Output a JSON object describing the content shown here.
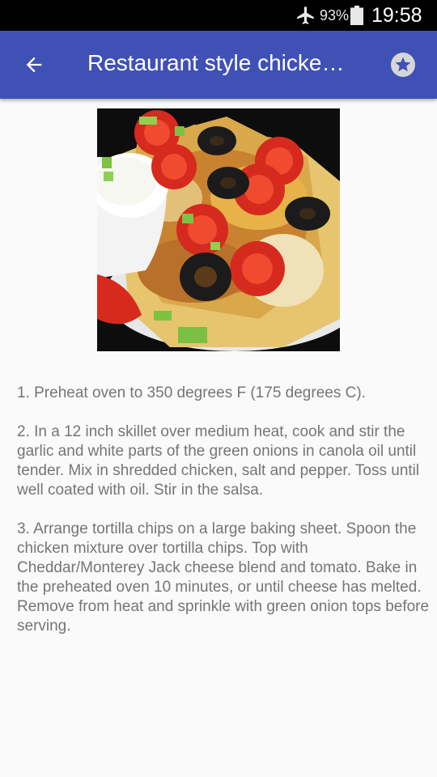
{
  "status_bar": {
    "battery": "93%",
    "time": "19:58",
    "icons": [
      "airplane-mode-icon",
      "battery-icon"
    ]
  },
  "app_bar": {
    "title": "Restaurant style chicke…",
    "back_icon": "arrow-left-icon",
    "favorite_icon": "star-icon",
    "color": "#3f51b5"
  },
  "recipe": {
    "image_subject": "nachos with chicken, cheese, tomatoes, black olives, green onions and sour cream",
    "steps": [
      "1. Preheat oven to 350 degrees F (175 degrees C).",
      "2. In a 12 inch skillet over medium heat, cook and stir the garlic and white parts of the green onions in canola oil until tender. Mix in shredded chicken, salt and pepper. Toss until well coated with oil. Stir in the salsa.",
      "3. Arrange tortilla chips on a large baking sheet. Spoon the chicken mixture over tortilla chips. Top with Cheddar/Monterey Jack cheese blend and tomato. Bake in the preheated oven 10 minutes, or until cheese has melted. Remove from heat and sprinkle with green onion tops before serving."
    ]
  }
}
